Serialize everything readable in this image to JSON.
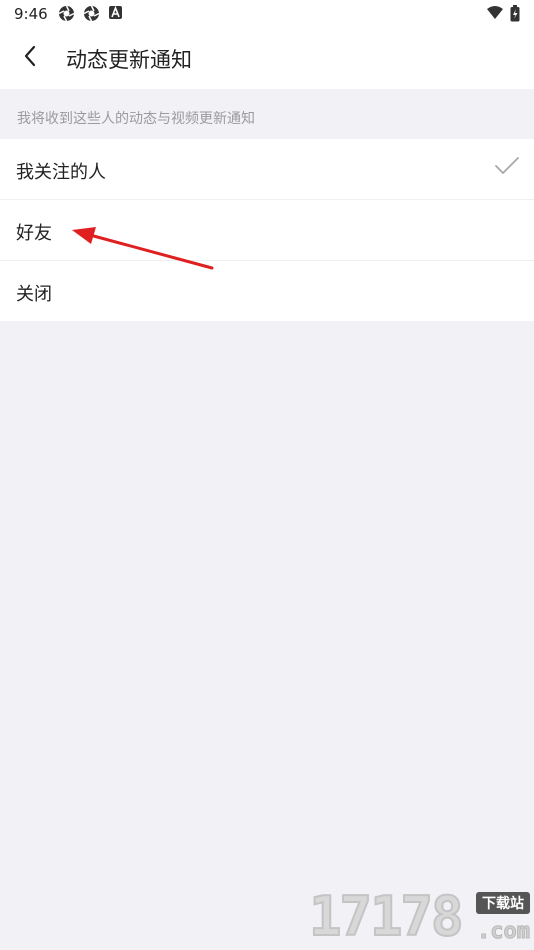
{
  "status_bar": {
    "time": "9:46",
    "left_icons": [
      "aperture-icon",
      "aperture-icon",
      "notification-a-icon"
    ],
    "right_icons": [
      "wifi-icon",
      "battery-charging-icon"
    ]
  },
  "nav": {
    "back_icon": "chevron-left-icon",
    "title": "动态更新通知"
  },
  "section": {
    "header": "我将收到这些人的动态与视频更新通知"
  },
  "options": [
    {
      "label": "我关注的人",
      "selected": true
    },
    {
      "label": "好友",
      "selected": false
    },
    {
      "label": "关闭",
      "selected": false
    }
  ],
  "annotation": {
    "color": "#e02020"
  },
  "watermark": {
    "number": "17178",
    "badge": "下载站",
    "domain": ".com"
  }
}
